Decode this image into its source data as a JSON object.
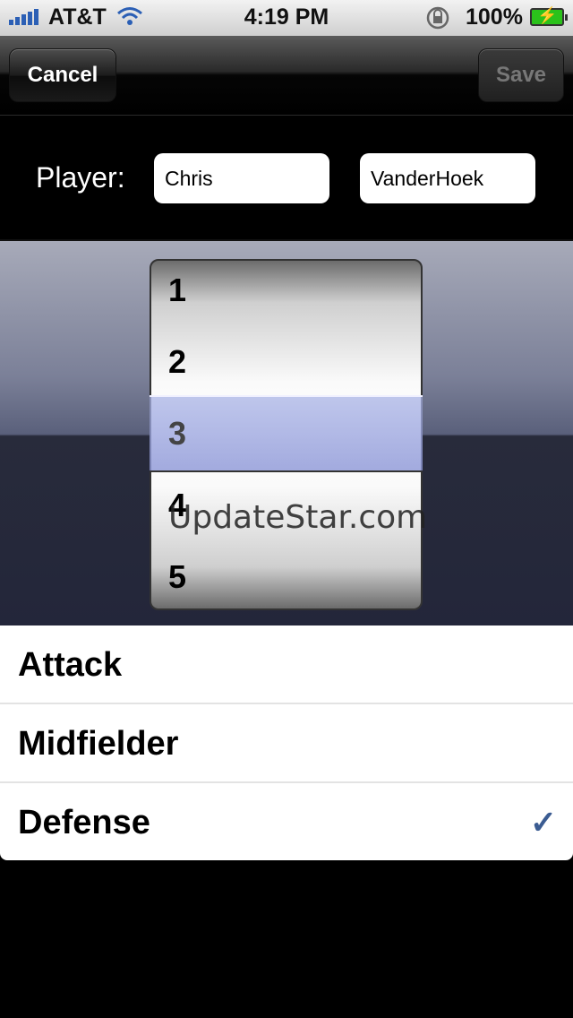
{
  "status_bar": {
    "carrier": "AT&T",
    "time": "4:19 PM",
    "battery": "100%"
  },
  "nav": {
    "cancel_label": "Cancel",
    "save_label": "Save"
  },
  "player": {
    "label": "Player:",
    "first_name": "Chris",
    "last_name": "VanderHoek"
  },
  "picker": {
    "numbers": [
      "1",
      "2",
      "3",
      "4",
      "5"
    ],
    "selected": "3",
    "watermark": "UpdateStar.com"
  },
  "positions": [
    {
      "label": "Attack",
      "checked": false
    },
    {
      "label": "Midfielder",
      "checked": false
    },
    {
      "label": "Defense",
      "checked": true
    }
  ],
  "colors": {
    "checkmark": "#3b5c92",
    "selection_band": "#a0a8dd"
  }
}
